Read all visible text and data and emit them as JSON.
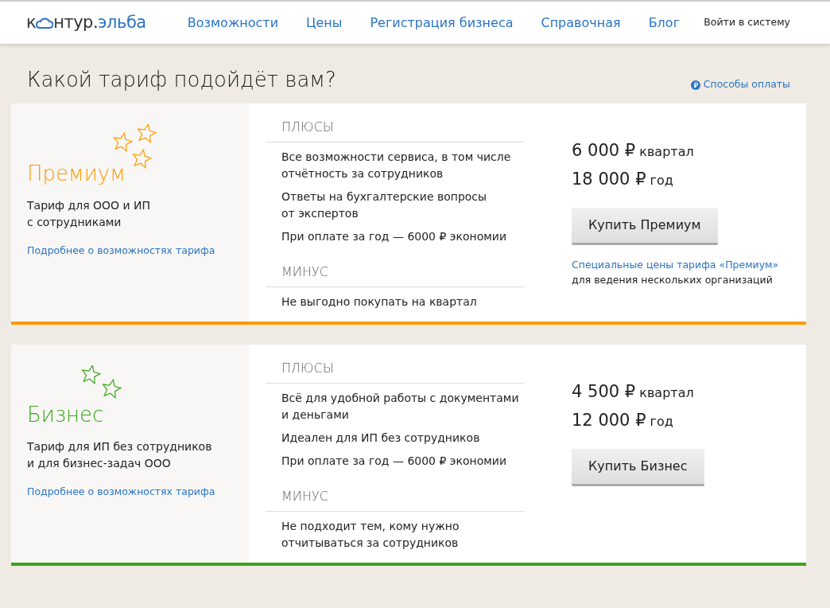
{
  "header": {
    "logo": {
      "before": "к",
      "after": "нтур.",
      "accent": "эльба"
    },
    "nav": [
      {
        "label": "Возможности"
      },
      {
        "label": "Цены"
      },
      {
        "label": "Регистрация бизнеса"
      },
      {
        "label": "Справочная"
      },
      {
        "label": "Блог"
      }
    ],
    "login": "Войти в систему"
  },
  "title": "Какой тариф подойдёт вам?",
  "payment_link": "Способы оплаты",
  "plans": [
    {
      "name": "Премиум",
      "color": "#ff9900",
      "kind": "premium",
      "description": [
        "Тариф для ООО и ИП",
        "с сотрудниками"
      ],
      "details_link": "Подробнее о возможностях тарифа",
      "pros_title": "ПЛЮСЫ",
      "pros": [
        [
          "Все возможности сервиса, в том числе",
          "отчётность за сотрудников"
        ],
        [
          "Ответы на бухгалтерские вопросы",
          "от экспертов"
        ],
        [
          "При оплате за год — 6000 ₽ экономии"
        ]
      ],
      "cons_title": "МИНУС",
      "cons": [
        [
          "Не выгодно покупать на квартал"
        ]
      ],
      "prices": [
        {
          "amount": "6 000 ₽",
          "period": "квартал"
        },
        {
          "amount": "18 000 ₽",
          "period": "год"
        }
      ],
      "buy_button": "Купить Премиум",
      "special_link": "Специальные цены тарифа «Премиум»",
      "special_note": "для ведения нескольких организаций"
    },
    {
      "name": "Бизнес",
      "color": "#3aa41c",
      "kind": "business",
      "description": [
        "Тариф для ИП без сотрудников",
        "и для бизнес-задач ООО"
      ],
      "details_link": "Подробнее о возможностях тарифа",
      "pros_title": "ПЛЮСЫ",
      "pros": [
        [
          "Всё для удобной работы с документами",
          "и деньгами"
        ],
        [
          "Идеален для ИП без сотрудников"
        ],
        [
          "При оплате за год — 6000 ₽ экономии"
        ]
      ],
      "cons_title": "МИНУС",
      "cons": [
        [
          "Не подходит тем, кому нужно",
          "отчитываться за сотрудников"
        ]
      ],
      "prices": [
        {
          "amount": "4 500 ₽",
          "period": "квартал"
        },
        {
          "amount": "12 000 ₽",
          "period": "год"
        }
      ],
      "buy_button": "Купить Бизнес"
    }
  ]
}
